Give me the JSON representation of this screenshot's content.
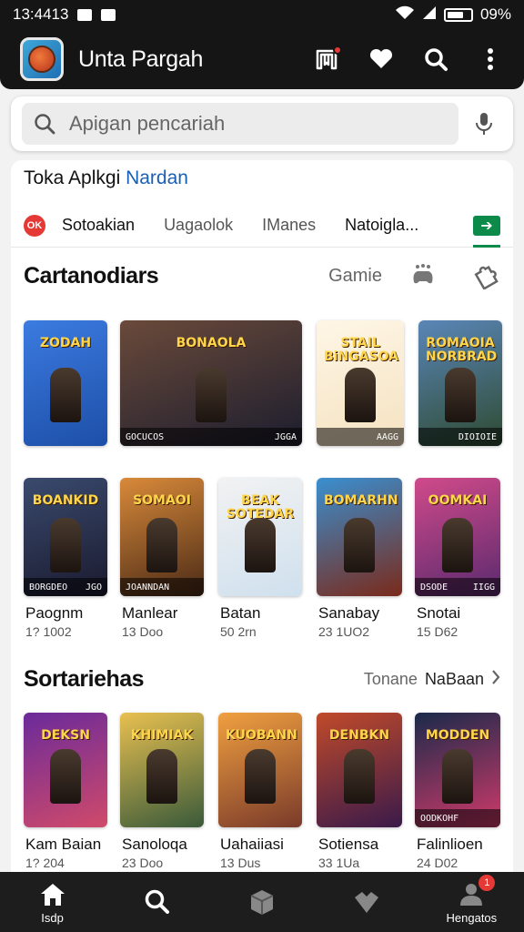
{
  "status_bar": {
    "time": "13:4413",
    "battery": "09%"
  },
  "app_bar": {
    "title": "Unta Pargah",
    "logo_icon": "game-app-logo"
  },
  "search": {
    "placeholder": "Apigan pencariah"
  },
  "store": {
    "title_prefix": "Toka Aplkgi",
    "title_accent": "Nardan"
  },
  "tabs": {
    "badge": "OK",
    "items": [
      "Sotoakian",
      "Uagaolok",
      "IManes",
      "Natoigla..."
    ]
  },
  "section1": {
    "title": "Cartanodiars",
    "filter": "Gamie"
  },
  "row1": [
    {
      "label": "ZODAH",
      "colors": [
        "#3c7be0",
        "#1d4fa8"
      ]
    },
    {
      "label": "BONAOLA",
      "foot_left": "GOCUCOS",
      "foot_right": "JGGA",
      "colors": [
        "#6a4a3a",
        "#1c1d2e"
      ]
    },
    {
      "label": "STAIL BiNGASOA",
      "foot_right": "AAGG",
      "colors": [
        "#fef6e6",
        "#f5e2c0"
      ]
    },
    {
      "label": "ROMAOIA NORBRAD",
      "foot_right": "DIOIOIE",
      "colors": [
        "#5a86b8",
        "#2e4a30"
      ]
    }
  ],
  "row2": [
    {
      "label": "BOANKID",
      "foot_left": "BORGDEO",
      "foot_right": "JGO",
      "colors": [
        "#3a4a6e",
        "#1a1a2e"
      ],
      "name": "Paognm",
      "meta": "1? 1002"
    },
    {
      "label": "SOMAOI",
      "foot_left": "JOANNDAN",
      "colors": [
        "#d98a3a",
        "#4a2a16"
      ],
      "name": "Manlear",
      "meta": "13 Doo"
    },
    {
      "label": "BEAK SOTEDAR",
      "colors": [
        "#f2f2f2",
        "#cfe0ee"
      ],
      "name": "Batan",
      "meta": "50 2rn"
    },
    {
      "label": "BOMARHN",
      "colors": [
        "#3a8fd0",
        "#7a2a1a"
      ],
      "name": "Sanabay",
      "meta": "23 1UO2"
    },
    {
      "label": "OOMKAI",
      "foot_left": "DSODE",
      "foot_right": "IIGG",
      "colors": [
        "#d04a8a",
        "#5a2a6e"
      ],
      "name": "Snotai",
      "meta": "15 D62"
    }
  ],
  "section2": {
    "title": "Sortariehas",
    "see_more_muted": "Tonane",
    "see_more": "NaBaan"
  },
  "row3": [
    {
      "label": "DEKSN",
      "colors": [
        "#6a2a9a",
        "#d04a6a"
      ],
      "name": "Kam Baian",
      "meta": "1? 204"
    },
    {
      "label": "KHIMIAK",
      "colors": [
        "#e8c050",
        "#3a5a3a"
      ],
      "name": "Sanoloqa",
      "meta": "23 Doo"
    },
    {
      "label": "KUOBANN",
      "colors": [
        "#f0a040",
        "#7a3a2a"
      ],
      "name": "Uahaiiasi",
      "meta": "13 Dus"
    },
    {
      "label": "DENBKN",
      "colors": [
        "#c04a2a",
        "#3a1a4a"
      ],
      "name": "Sotiensa",
      "meta": "33 1Ua"
    },
    {
      "label": "MODDEN",
      "foot_left": "OODKOHF",
      "colors": [
        "#1a2a4a",
        "#d03a6a"
      ],
      "name": "Falinlioen",
      "meta": "24 D02"
    }
  ],
  "bottom_nav": [
    {
      "label": "Isdp",
      "icon": "home-icon"
    },
    {
      "label": "",
      "icon": "search-icon"
    },
    {
      "label": "",
      "icon": "box-icon"
    },
    {
      "label": "",
      "icon": "shield-icon"
    },
    {
      "label": "Hengatos",
      "icon": "person-icon",
      "badge": "1"
    }
  ]
}
